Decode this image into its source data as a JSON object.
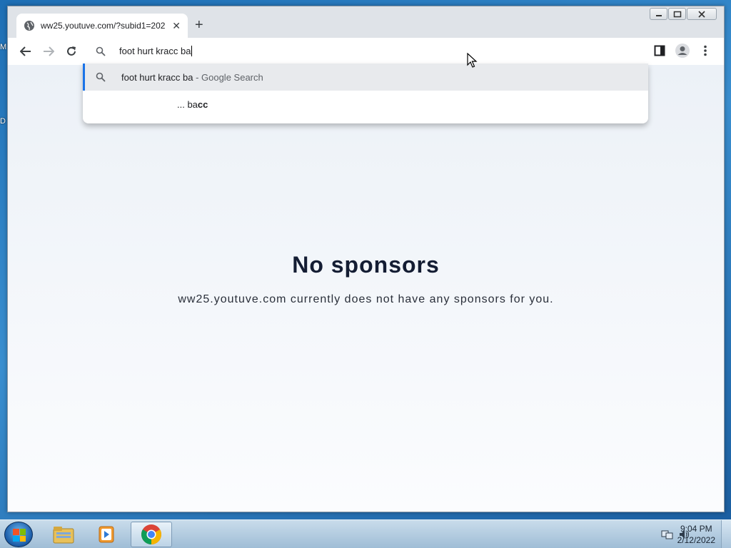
{
  "desktop": {
    "left_labels": [
      "M",
      "D"
    ]
  },
  "browser": {
    "tab": {
      "title": "ww25.youtuve.com/?subid1=202",
      "icon": "globe-icon"
    },
    "toolbar": {
      "back_icon": "back-arrow-icon",
      "forward_icon": "forward-arrow-icon",
      "reload_icon": "reload-icon"
    },
    "omnibox": {
      "value": "foot hurt kracc ba"
    },
    "suggestions": [
      {
        "query": "foot hurt kracc ba",
        "suffix": " - Google Search"
      },
      {
        "prefix": "... ba",
        "completion": "cc"
      }
    ]
  },
  "page": {
    "headline": "No sponsors",
    "message": "ww25.youtuve.com currently does not have any sponsors for you."
  },
  "taskbar": {
    "apps": [
      "file-explorer",
      "media-player",
      "chrome"
    ],
    "clock_time": "9:04 PM",
    "clock_date": "2/12/2022"
  },
  "colors": {
    "accent": "#1a73e8",
    "headline": "#141d33"
  }
}
